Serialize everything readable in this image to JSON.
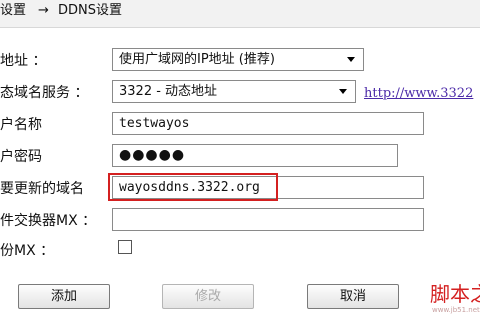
{
  "breadcrumb": {
    "parent": "设置",
    "arrow": "→",
    "current": "DDNS设置"
  },
  "form": {
    "wan_address": {
      "label": "地址 ：",
      "value": "使用广域网的IP地址 (推荐)"
    },
    "ddns_service": {
      "label": "态域名服务 ：",
      "value": "3322 - 动态地址",
      "link": "http://www.3322"
    },
    "username": {
      "label": "户名称",
      "value": "testwayos"
    },
    "password": {
      "label": "户密码",
      "value": "●●●●●"
    },
    "domain": {
      "label": "要更新的域名",
      "value": "wayosddns.3322.org"
    },
    "mx": {
      "label": "件交换器MX ：",
      "value": ""
    },
    "backup_mx": {
      "label": "份MX ：",
      "checked": false
    }
  },
  "buttons": {
    "add": "添加",
    "modify": "修改",
    "cancel": "取消"
  },
  "watermark": {
    "text": "脚本之",
    "url": "www.jb51.net"
  }
}
